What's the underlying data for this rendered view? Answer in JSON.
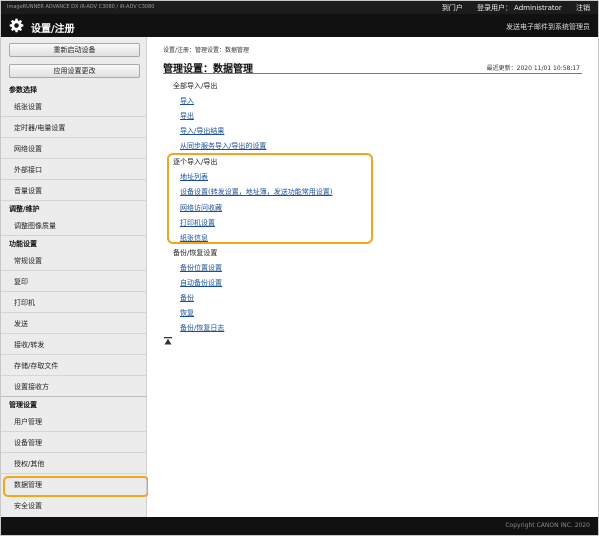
{
  "top_bar": {
    "device_info": "ImageRUNNER ADVANCE DX   iR-ADV C3080 / iR-ADV C3080",
    "portal": "到门户",
    "login_label": "登录用户：",
    "user": "Administrator",
    "logout": "注销"
  },
  "header": {
    "title": "设置/注册",
    "notice": "发送电子邮件到系统管理员"
  },
  "sidebar": {
    "buttons": [
      "重新启动设备",
      "应用设置更改"
    ],
    "sections": [
      {
        "title": "参数选择",
        "items": [
          "纸张设置",
          "定时器/电量设置",
          "网络设置",
          "外部接口",
          "音量设置"
        ]
      },
      {
        "title": "调整/维护",
        "items": [
          "调整图像质量"
        ]
      },
      {
        "title": "功能设置",
        "items": [
          "常规设置",
          "复印",
          "打印机",
          "发送",
          "接收/转发",
          "存储/存取文件"
        ]
      },
      {
        "title": "",
        "items": [
          "设置接收方"
        ]
      },
      {
        "title": "管理设置",
        "items": [
          "用户管理",
          "设备管理",
          "授权/其他",
          "数据管理",
          "安全设置"
        ]
      }
    ],
    "active": "数据管理"
  },
  "main": {
    "breadcrumb": "设置/注册：管理设置：数据管理",
    "title": "管理设置：数据管理",
    "updated": "最近更新：2020 11/01 10:58:17",
    "groups": [
      {
        "label": "全部导入/导出",
        "links": [
          "导入",
          "导出",
          "导入/导出结果",
          "从同步服务导入/导出的设置"
        ]
      },
      {
        "label": "逐个导入/导出",
        "links": [
          "地址列表",
          "设备设置(转发设置，地址簿，发送功能常用设置)",
          "网络访问收藏",
          "打印机设置",
          "纸张信息"
        ]
      },
      {
        "label": "备份/恢复设置",
        "links": [
          "备份位置设置",
          "自动备份设置",
          "备份",
          "恢复",
          "备份/恢复日志"
        ]
      }
    ]
  },
  "footer": {
    "copyright": "Copyright CANON INC. 2020"
  },
  "colors": {
    "highlight": "#f2a51e",
    "link": "#1a4f9c",
    "header_bg": "#111111"
  },
  "icons": {
    "header": "gear-icon",
    "back_to_top": "back-to-top-icon"
  }
}
